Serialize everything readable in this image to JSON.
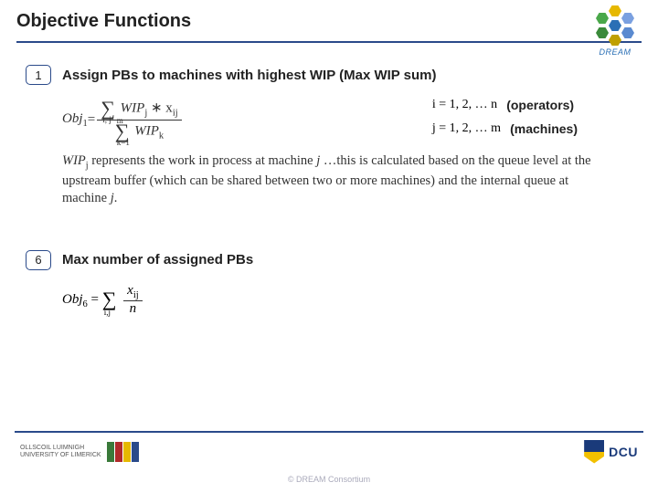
{
  "title": "Objective Functions",
  "brand": {
    "name": "DREAM"
  },
  "objectives": {
    "o1": {
      "num": "1",
      "text": "Assign PBs to machines with highest WIP (Max WIP sum)",
      "formula_lhs": "Obj",
      "formula_lhs_sub": "1",
      "formula_eq": " = ",
      "numerator_sum_sub": "i, j",
      "numerator_body": " WIP",
      "numerator_body_sub": "j",
      "numerator_mul": " ∗ x",
      "numerator_x_sub": "ij",
      "denominator_sum_sub": "k=1",
      "denominator_sum_sup": "m",
      "denominator_body": " WIP",
      "denominator_body_sub": "k",
      "idx_i": "i = 1, 2, … n",
      "idx_i_label": "(operators)",
      "idx_j": "j = 1, 2, … m",
      "idx_j_label": "(machines)",
      "desc_1": "WIP",
      "desc_1_sub": "j",
      "desc_2": " represents the work in process at machine ",
      "desc_3": "j",
      "desc_4": " …this is calculated based on the queue level at the upstream buffer (which can be shared between two or more machines) and the internal queue at machine ",
      "desc_5": "j",
      "desc_6": "."
    },
    "o6": {
      "num": "6",
      "text": "Max number of assigned PBs",
      "formula_lhs": "Obj",
      "formula_lhs_sub": "6",
      "formula_eq": " = ",
      "sum_sub": "i,j",
      "num_body": "x",
      "num_body_sub": "ij",
      "den_body": "n"
    }
  },
  "footer": {
    "ul_line1": "OLLSCOIL LUIMNIGH",
    "ul_line2": "UNIVERSITY OF LIMERICK",
    "copyright": "© DREAM Consortium",
    "dcu": "DCU"
  },
  "colors": {
    "accent": "#2a4a8a"
  }
}
